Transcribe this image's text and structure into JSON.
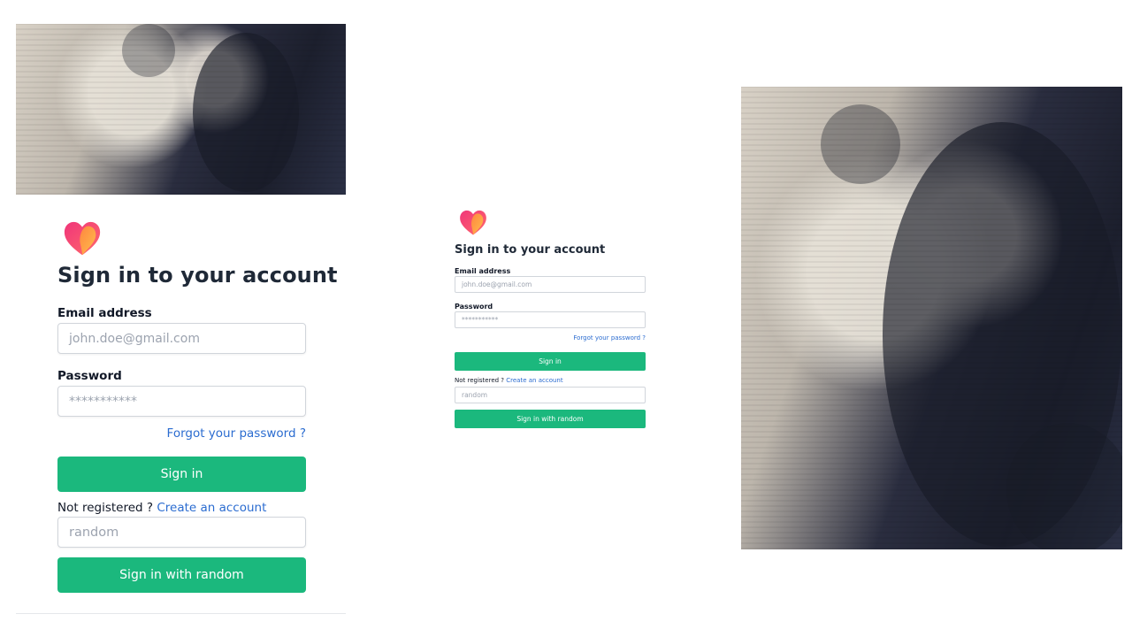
{
  "login": {
    "logo_icon": "heart-logo-icon",
    "title": "Sign in to your account",
    "email_label": "Email address",
    "email_placeholder": "john.doe@gmail.com",
    "password_label": "Password",
    "password_placeholder": "***********",
    "forgot_link": "Forgot your password ?",
    "signin_button": "Sign in",
    "not_registered": "Not registered ?",
    "create_account_link": "Create an account",
    "random_placeholder": "random",
    "random_button": "Sign in with random"
  },
  "colors": {
    "primary": "#1bb87d",
    "link": "#2b6cd0",
    "heading": "#1f2937",
    "logo_gradient": [
      "#f0357a",
      "#ff8a3d",
      "#ffc24a"
    ]
  },
  "images": {
    "hero_alt_icon": "couple-photo",
    "side_alt_icon": "couple-photo"
  }
}
